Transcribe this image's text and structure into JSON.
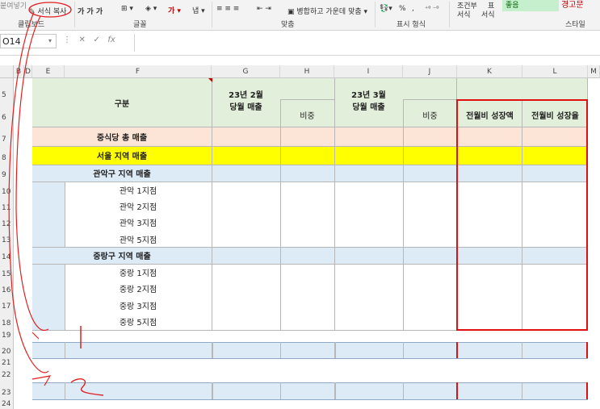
{
  "ribbon": {
    "clipboard_top": "붙여넣기",
    "format_copy": "서식 복사",
    "clipboard_group": "클립보드",
    "font_group": "글꼴",
    "align_group": "맞춤",
    "merge_label": "병합하고 가운데 맞춤",
    "number_group": "표시 형식",
    "percent": "%",
    "cond_format_1": "조건부",
    "cond_format_2": "서식",
    "table_1": "표",
    "table_2": "서식",
    "style_good": "좋음",
    "style_bad": "경고문",
    "style_group": "스타일",
    "font_buttons": "가 가 가"
  },
  "formula_bar": {
    "name_box": "O14",
    "fx": "fx",
    "value": ""
  },
  "columns": [
    "B",
    "D",
    "E",
    "F",
    "G",
    "H",
    "I",
    "J",
    "K",
    "L",
    "M"
  ],
  "rows": [
    "5",
    "6",
    "7",
    "8",
    "9",
    "10",
    "11",
    "12",
    "13",
    "14",
    "15",
    "16",
    "17",
    "18",
    "19",
    "20",
    "21",
    "22",
    "23",
    "24"
  ],
  "table": {
    "header_category": "구분",
    "header_feb": "23년 2월\n당월 매출",
    "header_mar": "23년 3월\n당월 매출",
    "header_ratio1": "비중",
    "header_ratio2": "비중",
    "header_growth_amt": "전월비 성장액",
    "header_growth_rate": "전월비 성장율",
    "total_sales": "중식당 총 매출",
    "seoul_sales": "서울 지역 매출",
    "gwanak_sales": "관악구 지역 매출",
    "gwanak_stores": [
      "관악 1지점",
      "관악 2지점",
      "관악 3지점",
      "관악 5지점"
    ],
    "jungnang_sales": "중랑구 지역 매출",
    "jungnang_stores": [
      "중랑 1지점",
      "중랑 2지점",
      "중랑 3지점",
      "중랑 5지점"
    ]
  },
  "annotations": {
    "mark1": "1",
    "mark2": "2"
  },
  "colors": {
    "header_green": "#e2efda",
    "total_peach": "#fce4d6",
    "seoul_yellow": "#ffff00",
    "region_blue": "#ddebf7",
    "highlight_red": "#e01010"
  }
}
